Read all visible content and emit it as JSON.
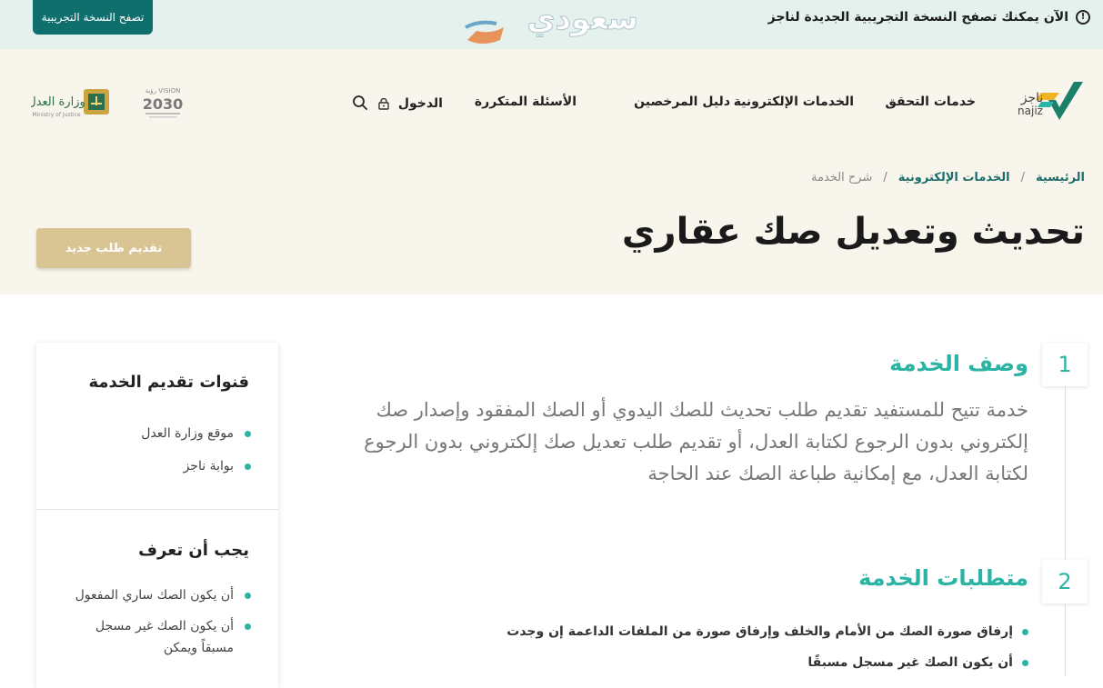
{
  "banner": {
    "message": "الآن يمكنك تصفح النسخة التجريبية الجديدة لناجز",
    "beta_button": "تصفح النسخة التجريبية",
    "watermark_text": "سعودي"
  },
  "nav": {
    "logo_text": "ناجز",
    "logo_latin": "najiz",
    "items": [
      "خدمات التحقق",
      "الخدمات الإلكترونية",
      "دليل المرخصين",
      "الأسئلة المتكررة"
    ],
    "login": "الدخول",
    "vision_top": "VISION رؤية",
    "vision_year": "2030",
    "moj_text": "وزارة العدل",
    "moj_latin": "Ministry of Justice"
  },
  "breadcrumb": [
    "الرئيسية",
    "الخدمات الإلكترونية",
    "شرح الخدمة"
  ],
  "page": {
    "title": "تحديث وتعديل صك عقاري",
    "new_request": "تقديم طلب جديد"
  },
  "sections": [
    {
      "number": "1",
      "title": "وصف الخدمة",
      "text": "خدمة تتيح للمستفيد تقديم طلب تحديث للصك اليدوي أو الصك المفقود وإصدار صك إلكتروني بدون الرجوع لكتابة العدل، أو تقديم طلب تعديل صك إلكتروني بدون الرجوع لكتابة العدل، مع إمكانية طباعة الصك عند الحاجة"
    },
    {
      "number": "2",
      "title": "متطلبات الخدمة",
      "items": [
        "إرفاق صورة الصك من الأمام والخلف وإرفاق صورة من الملفات الداعمة إن وجدت",
        "أن يكون الصك غير مسجل مسبقًا"
      ]
    }
  ],
  "sidebar": {
    "channels_title": "قنوات تقديم الخدمة",
    "channels": [
      "موقع وزارة العدل",
      "بوابة ناجز"
    ],
    "know_title": "يجب أن تعرف",
    "know": [
      "أن يكون الصك ساري المفعول",
      "أن يكون الصك غير مسجل مسبقاً ويمكن"
    ]
  },
  "colors": {
    "teal": "#2bb3a3",
    "dark_teal": "#0f6f6c",
    "gold": "#d8c593",
    "header_bg": "#f8f5ec",
    "banner_bg": "#e4f1ec"
  }
}
